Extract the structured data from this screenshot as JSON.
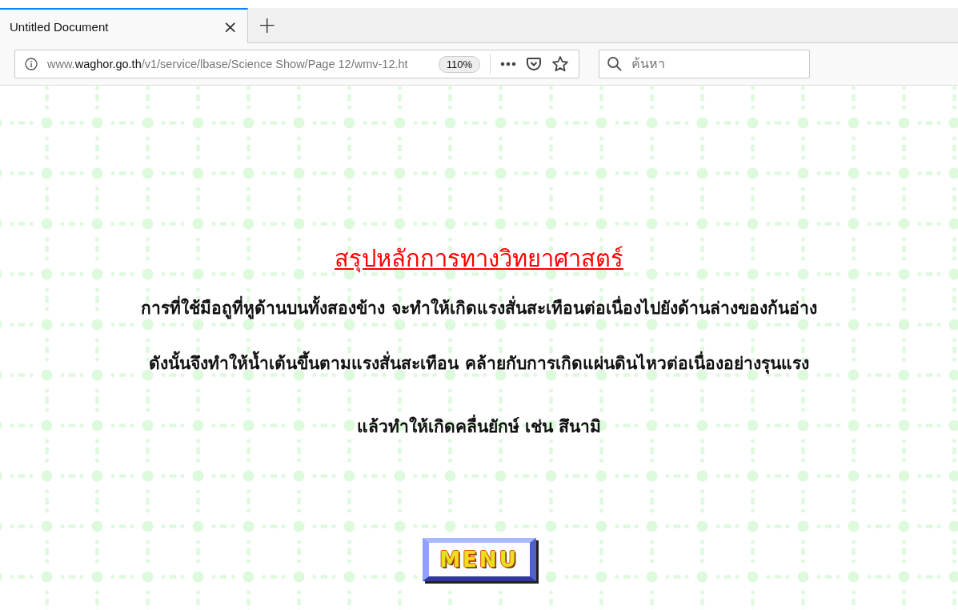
{
  "tabs": [
    {
      "title": "Untitled Document",
      "close": "×",
      "selected": true
    }
  ],
  "new_tab": "+",
  "address_bar": {
    "prefix": "www.",
    "domain": "waghor.go.th",
    "path": "/v1/service/lbase/Science Show/Page 12/wmv-12.ht",
    "zoom": "110%"
  },
  "search": {
    "placeholder": "ค้นหา"
  },
  "content": {
    "title": "สรุปหลักการทางวิทยาศาสตร์",
    "lines": [
      "การที่ใช้มือถูที่หูด้านบนทั้งสองข้าง จะทำให้เกิดแรงสั่นสะเทือนต่อเนื่องไปยังด้านล่างของก้นอ่าง",
      "ดังนั้นจึงทำให้น้ำเต้นขึ้นตามแรงสั่นสะเทือน คล้ายกับการเกิดแผ่นดินไหวต่อเนื่องอย่างรุนแรง",
      "แล้วทำให้เกิดคลื่นยักษ์ เช่น สึนามิ"
    ],
    "menu_button": "MENU"
  }
}
